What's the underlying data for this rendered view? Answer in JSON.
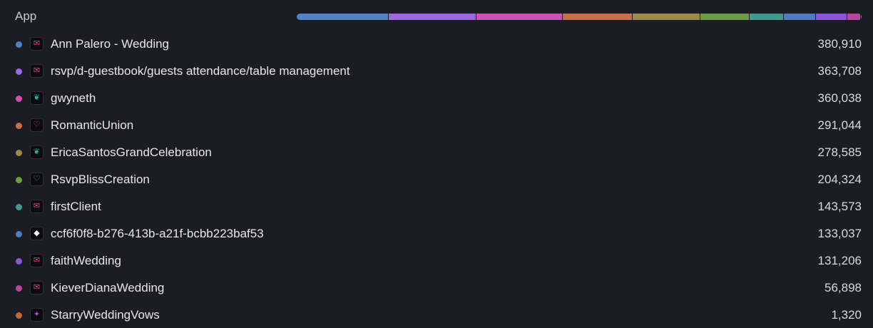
{
  "header": {
    "title": "App"
  },
  "rows": [
    {
      "name": "Ann Palero - Wedding",
      "value": "380,910",
      "share": 380910,
      "color": "#4f82c7",
      "icon": "envelope-icon",
      "glyph": "✉",
      "glyph_color": "#e0447a"
    },
    {
      "name": "rsvp/d-guestbook/guests attendance/table management",
      "value": "363,708",
      "share": 363708,
      "color": "#9b6ae0",
      "icon": "envelope-icon",
      "glyph": "✉",
      "glyph_color": "#e0447a"
    },
    {
      "name": "gwyneth",
      "value": "360,038",
      "share": 360038,
      "color": "#d04fb5",
      "icon": "rose-icon",
      "glyph": "❦",
      "glyph_color": "#2bb3a8"
    },
    {
      "name": "RomanticUnion",
      "value": "291,044",
      "share": 291044,
      "color": "#c8704a",
      "icon": "heart-icon",
      "glyph": "♡",
      "glyph_color": "#e04466"
    },
    {
      "name": "EricaSantosGrandCelebration",
      "value": "278,585",
      "share": 278585,
      "color": "#9a8a4e",
      "icon": "rose-icon",
      "glyph": "❦",
      "glyph_color": "#2bb3a8"
    },
    {
      "name": "RsvpBlissCreation",
      "value": "204,324",
      "share": 204324,
      "color": "#6f9a48",
      "icon": "heart-icon",
      "glyph": "♡",
      "glyph_color": "#2bc0b0"
    },
    {
      "name": "firstClient",
      "value": "143,573",
      "share": 143573,
      "color": "#3f9a8e",
      "icon": "envelope-icon",
      "glyph": "✉",
      "glyph_color": "#e0447a"
    },
    {
      "name": "ccf6f0f8-b276-413b-a21f-bcbb223baf53",
      "value": "133,037",
      "share": 133037,
      "color": "#4f7cc0",
      "icon": "cube-icon",
      "glyph": "◆",
      "glyph_color": "#f2f2f2"
    },
    {
      "name": "faithWedding",
      "value": "131,206",
      "share": 131206,
      "color": "#8a55d8",
      "icon": "envelope-icon",
      "glyph": "✉",
      "glyph_color": "#e0447a"
    },
    {
      "name": "KieverDianaWedding",
      "value": "56,898",
      "share": 56898,
      "color": "#b5489a",
      "icon": "envelope-icon",
      "glyph": "✉",
      "glyph_color": "#e0447a"
    },
    {
      "name": "StarryWeddingVows",
      "value": "1,320",
      "share": 1320,
      "color": "#c06a3e",
      "icon": "sparkle-icon",
      "glyph": "✦",
      "glyph_color": "#a64fd0"
    }
  ]
}
